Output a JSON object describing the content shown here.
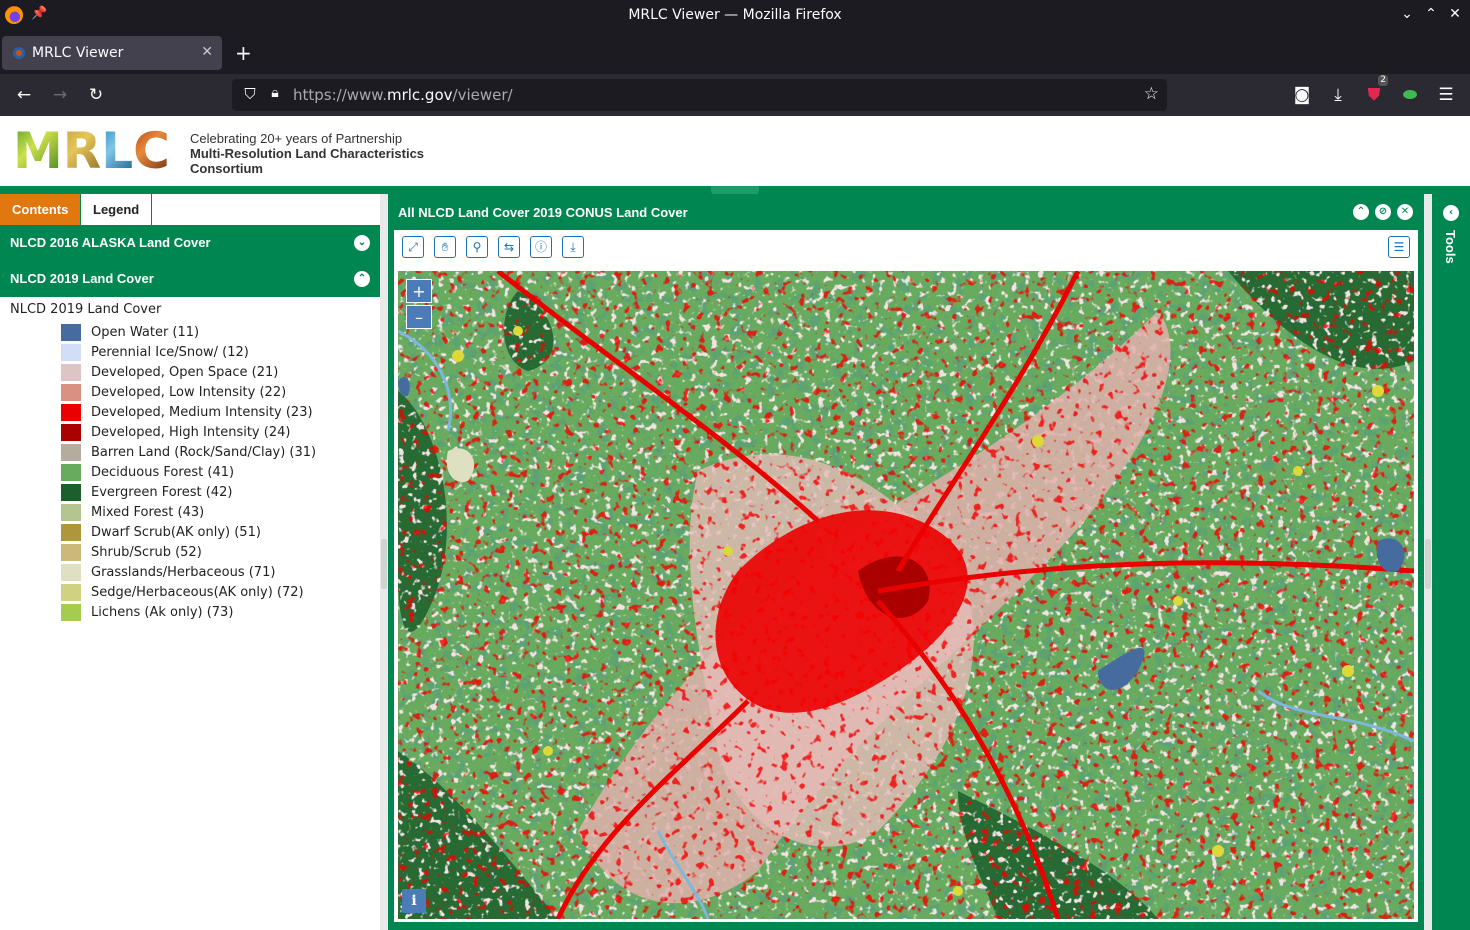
{
  "browser": {
    "window_title": "MRLC Viewer — Mozilla Firefox",
    "tab_title": "MRLC Viewer",
    "url_prefix": "https://www.",
    "url_domain": "mrlc.gov",
    "url_path": "/viewer/",
    "extension_badge": "2"
  },
  "site": {
    "logo_letters": [
      "M",
      "R",
      "L",
      "C"
    ],
    "tagline": "Celebrating 20+ years of Partnership",
    "org_line1": "Multi-Resolution Land Characteristics",
    "org_line2": "Consortium"
  },
  "panel": {
    "tabs": [
      "Contents",
      "Legend"
    ],
    "active_tab": "Contents",
    "layers": [
      {
        "title": "NLCD 2016 ALASKA Land Cover",
        "expanded": false
      },
      {
        "title": "NLCD 2019 Land Cover",
        "expanded": true
      }
    ],
    "legend_title": "NLCD 2019 Land Cover",
    "legend": [
      {
        "label": "Open Water (11)",
        "color": "#466b9f"
      },
      {
        "label": "Perennial Ice/Snow/ (12)",
        "color": "#d1def8"
      },
      {
        "label": "Developed, Open Space (21)",
        "color": "#dec5c5"
      },
      {
        "label": "Developed, Low Intensity (22)",
        "color": "#d99282"
      },
      {
        "label": "Developed, Medium Intensity (23)",
        "color": "#eb0000"
      },
      {
        "label": "Developed, High Intensity (24)",
        "color": "#ab0000"
      },
      {
        "label": "Barren Land (Rock/Sand/Clay) (31)",
        "color": "#b3ac9f"
      },
      {
        "label": "Deciduous Forest (41)",
        "color": "#68ab5f"
      },
      {
        "label": "Evergreen Forest (42)",
        "color": "#1c5f2c"
      },
      {
        "label": "Mixed Forest (43)",
        "color": "#b5c58f"
      },
      {
        "label": "Dwarf Scrub(AK only) (51)",
        "color": "#af963c"
      },
      {
        "label": "Shrub/Scrub (52)",
        "color": "#ccb879"
      },
      {
        "label": "Grasslands/Herbaceous (71)",
        "color": "#dfdfc2"
      },
      {
        "label": "Sedge/Herbaceous(AK only) (72)",
        "color": "#d1d182"
      },
      {
        "label": "Lichens (Ak only) (73)",
        "color": "#a3cc51"
      }
    ]
  },
  "map": {
    "title": "All NLCD Land Cover 2019 CONUS Land Cover",
    "zoom_in": "+",
    "zoom_out": "–",
    "info": "i",
    "tools_label": "Tools"
  },
  "colors": {
    "accent_green": "#008751",
    "tab_orange": "#e0770f"
  }
}
